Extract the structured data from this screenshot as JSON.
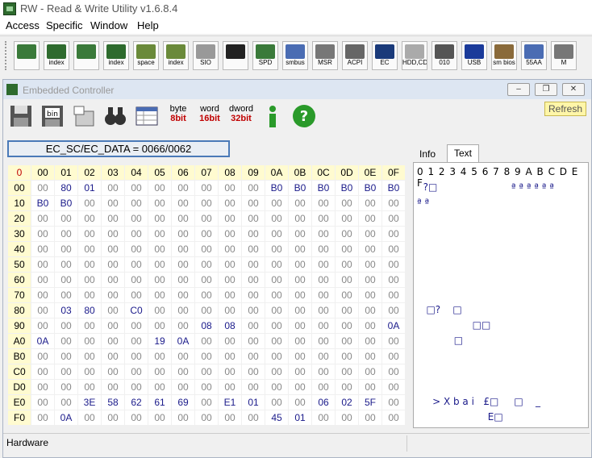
{
  "app": {
    "title": "RW - Read & Write Utility v1.6.8.4"
  },
  "menu": {
    "items": [
      "Access",
      "Specific",
      "Window",
      "Help"
    ]
  },
  "toolbar": {
    "buttons": [
      {
        "name": "pci-icon",
        "label": ""
      },
      {
        "name": "pci-index-icon",
        "label": "index"
      },
      {
        "name": "memory-icon",
        "label": ""
      },
      {
        "name": "memory-index-icon",
        "label": "index"
      },
      {
        "name": "io-space-icon",
        "label": "space"
      },
      {
        "name": "io-index-icon",
        "label": "index"
      },
      {
        "name": "sio-icon",
        "label": "SIO"
      },
      {
        "name": "oscilloscope-icon",
        "label": ""
      },
      {
        "name": "spd-icon",
        "label": "SPD"
      },
      {
        "name": "smbus-icon",
        "label": "smbus"
      },
      {
        "name": "msr-icon",
        "label": "MSR"
      },
      {
        "name": "acpi-icon",
        "label": "ACPI"
      },
      {
        "name": "ec-icon",
        "label": "EC"
      },
      {
        "name": "hdd-cd-icon",
        "label": "HDD,CD"
      },
      {
        "name": "disk-010-icon",
        "label": "010"
      },
      {
        "name": "usb-icon",
        "label": "USB"
      },
      {
        "name": "smbios-icon",
        "label": "sm bios"
      },
      {
        "name": "55aa-icon",
        "label": "55AA"
      },
      {
        "name": "more-icon",
        "label": "M"
      }
    ]
  },
  "child": {
    "title": "Embedded Controller",
    "tool_labels": {
      "byte_top": "byte",
      "byte_bottom": "8bit",
      "word_top": "word",
      "word_bottom": "16bit",
      "dword_top": "dword",
      "dword_bottom": "32bit"
    },
    "refresh": "Refresh",
    "address": "EC_SC/EC_DATA = 0066/0062",
    "tabs": [
      "Info",
      "Text"
    ],
    "text_header": "0 1 2 3 4 5 6 7 8 9 A B C D E F",
    "text_lines": [
      "  ?□                        ª ª ª ª ª ª",
      "ª ª",
      "",
      "",
      "",
      "",
      "",
      "",
      "   □?    □",
      "                  □□",
      "            □",
      "",
      "",
      "",
      "     > X b a i   £□     □    _",
      "                       E□"
    ]
  },
  "hex": {
    "corner": "0",
    "columns": [
      "00",
      "01",
      "02",
      "03",
      "04",
      "05",
      "06",
      "07",
      "08",
      "09",
      "0A",
      "0B",
      "0C",
      "0D",
      "0E",
      "0F"
    ],
    "rows": [
      {
        "addr": "00",
        "cells": [
          "00",
          "80",
          "01",
          "00",
          "00",
          "00",
          "00",
          "00",
          "00",
          "00",
          "B0",
          "B0",
          "B0",
          "B0",
          "B0",
          "B0"
        ]
      },
      {
        "addr": "10",
        "cells": [
          "B0",
          "B0",
          "00",
          "00",
          "00",
          "00",
          "00",
          "00",
          "00",
          "00",
          "00",
          "00",
          "00",
          "00",
          "00",
          "00"
        ]
      },
      {
        "addr": "20",
        "cells": [
          "00",
          "00",
          "00",
          "00",
          "00",
          "00",
          "00",
          "00",
          "00",
          "00",
          "00",
          "00",
          "00",
          "00",
          "00",
          "00"
        ]
      },
      {
        "addr": "30",
        "cells": [
          "00",
          "00",
          "00",
          "00",
          "00",
          "00",
          "00",
          "00",
          "00",
          "00",
          "00",
          "00",
          "00",
          "00",
          "00",
          "00"
        ]
      },
      {
        "addr": "40",
        "cells": [
          "00",
          "00",
          "00",
          "00",
          "00",
          "00",
          "00",
          "00",
          "00",
          "00",
          "00",
          "00",
          "00",
          "00",
          "00",
          "00"
        ]
      },
      {
        "addr": "50",
        "cells": [
          "00",
          "00",
          "00",
          "00",
          "00",
          "00",
          "00",
          "00",
          "00",
          "00",
          "00",
          "00",
          "00",
          "00",
          "00",
          "00"
        ]
      },
      {
        "addr": "60",
        "cells": [
          "00",
          "00",
          "00",
          "00",
          "00",
          "00",
          "00",
          "00",
          "00",
          "00",
          "00",
          "00",
          "00",
          "00",
          "00",
          "00"
        ]
      },
      {
        "addr": "70",
        "cells": [
          "00",
          "00",
          "00",
          "00",
          "00",
          "00",
          "00",
          "00",
          "00",
          "00",
          "00",
          "00",
          "00",
          "00",
          "00",
          "00"
        ]
      },
      {
        "addr": "80",
        "cells": [
          "00",
          "03",
          "80",
          "00",
          "C0",
          "00",
          "00",
          "00",
          "00",
          "00",
          "00",
          "00",
          "00",
          "00",
          "00",
          "00"
        ]
      },
      {
        "addr": "90",
        "cells": [
          "00",
          "00",
          "00",
          "00",
          "00",
          "00",
          "00",
          "08",
          "08",
          "00",
          "00",
          "00",
          "00",
          "00",
          "00",
          "0A"
        ]
      },
      {
        "addr": "A0",
        "cells": [
          "0A",
          "00",
          "00",
          "00",
          "00",
          "19",
          "0A",
          "00",
          "00",
          "00",
          "00",
          "00",
          "00",
          "00",
          "00",
          "00"
        ]
      },
      {
        "addr": "B0",
        "cells": [
          "00",
          "00",
          "00",
          "00",
          "00",
          "00",
          "00",
          "00",
          "00",
          "00",
          "00",
          "00",
          "00",
          "00",
          "00",
          "00"
        ]
      },
      {
        "addr": "C0",
        "cells": [
          "00",
          "00",
          "00",
          "00",
          "00",
          "00",
          "00",
          "00",
          "00",
          "00",
          "00",
          "00",
          "00",
          "00",
          "00",
          "00"
        ]
      },
      {
        "addr": "D0",
        "cells": [
          "00",
          "00",
          "00",
          "00",
          "00",
          "00",
          "00",
          "00",
          "00",
          "00",
          "00",
          "00",
          "00",
          "00",
          "00",
          "00"
        ]
      },
      {
        "addr": "E0",
        "cells": [
          "00",
          "00",
          "3E",
          "58",
          "62",
          "61",
          "69",
          "00",
          "E1",
          "01",
          "00",
          "00",
          "06",
          "02",
          "5F",
          "00"
        ]
      },
      {
        "addr": "F0",
        "cells": [
          "00",
          "0A",
          "00",
          "00",
          "00",
          "00",
          "00",
          "00",
          "00",
          "00",
          "45",
          "01",
          "00",
          "00",
          "00",
          "00"
        ]
      }
    ]
  },
  "status": {
    "text": "Hardware"
  },
  "colors": {
    "nonzero": "#1a1a8a",
    "zero": "#888888",
    "header_bg": "#fffbd0",
    "accent": "#4a7ab8"
  }
}
